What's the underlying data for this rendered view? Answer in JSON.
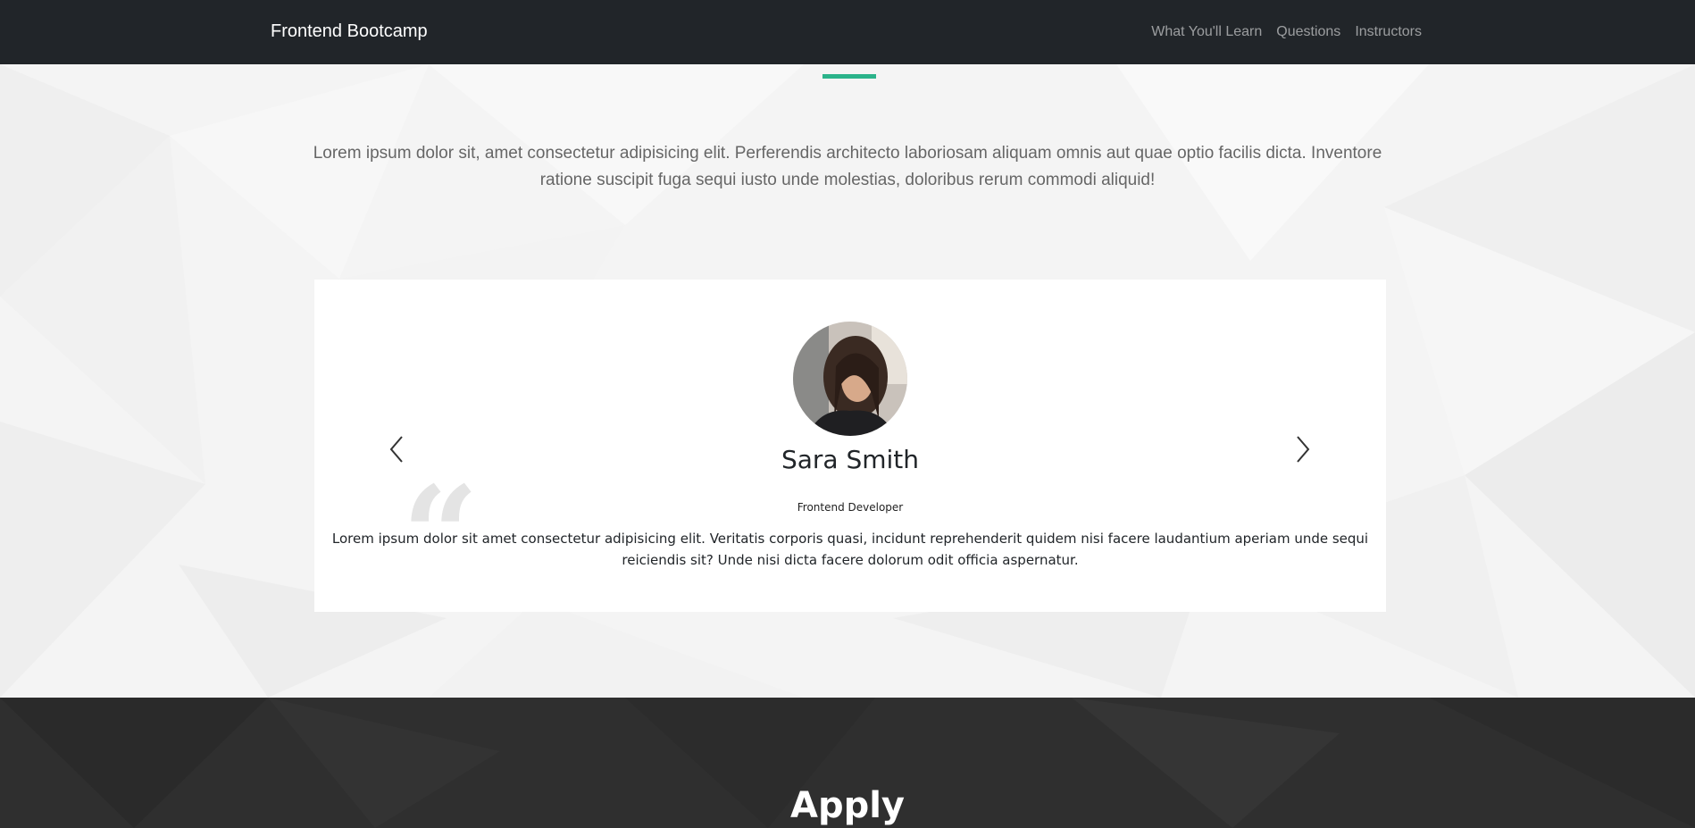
{
  "navbar": {
    "brand": "Frontend Bootcamp",
    "links": [
      {
        "label": "What You'll Learn"
      },
      {
        "label": "Questions"
      },
      {
        "label": "Instructors"
      }
    ]
  },
  "testimonials": {
    "intro": "Lorem ipsum dolor sit, amet consectetur adipisicing elit. Perferendis architecto laboriosam aliquam omnis aut quae optio facilis dicta. Inventore ratione suscipit fuga sequi iusto unde molestias, doloribus rerum commodi aliquid!",
    "quote_mark": "“",
    "current": {
      "name": "Sara Smith",
      "role": "Frontend Developer",
      "quote": "Lorem ipsum dolor sit amet consectetur adipisicing elit. Veritatis corporis quasi, incidunt reprehenderit quidem nisi facere laudantium aperiam unde sequi reiciendis sit? Unde nisi dicta facere dolorum odit officia aspernatur."
    },
    "prev_icon": "chevron-left-icon",
    "next_icon": "chevron-right-icon"
  },
  "apply": {
    "heading": "Apply"
  },
  "colors": {
    "navbar_bg": "#212529",
    "accent": "#2bb38a",
    "dark_section_bg": "#2f2f2f",
    "light_section_bg": "#f4f4f4"
  }
}
